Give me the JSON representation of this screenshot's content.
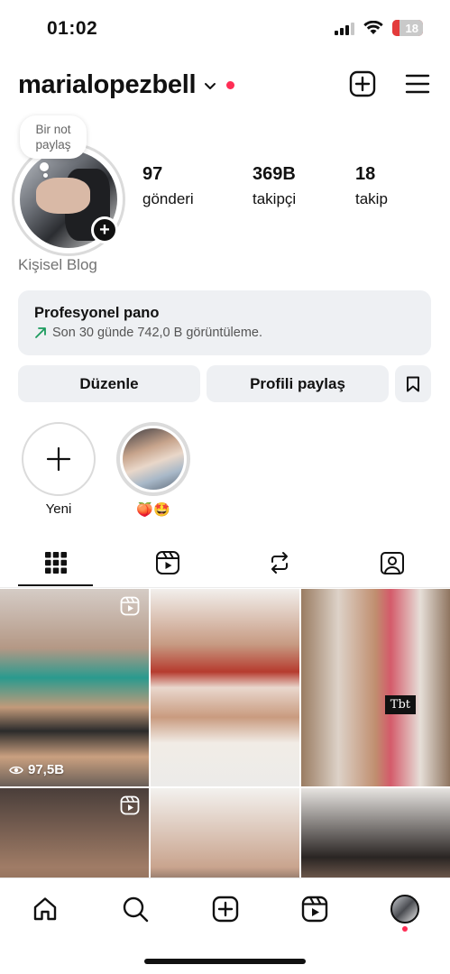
{
  "status_bar": {
    "time": "01:02",
    "battery": "18",
    "battery_color": "#e33b3b"
  },
  "header": {
    "username": "marialopezbell",
    "icons": [
      "chevron-down-icon",
      "notification-dot",
      "new-post-icon",
      "menu-icon"
    ]
  },
  "profile": {
    "note_bubble": "Bir not paylaş",
    "stats": {
      "posts": {
        "value": "97",
        "label": "gönderi"
      },
      "followers": {
        "value": "369B",
        "label": "takipçi"
      },
      "following": {
        "value": "18",
        "label": "takip"
      }
    },
    "bio": "Kişisel Blog"
  },
  "professional_panel": {
    "title": "Profesyonel pano",
    "subtitle": "Son 30 günde 742,0 B görüntüleme."
  },
  "buttons": {
    "edit": "Düzenle",
    "share": "Profili paylaş"
  },
  "highlights": [
    {
      "label": "Yeni"
    },
    {
      "label": "🍑🤩"
    }
  ],
  "tabs": [
    "grid-tab",
    "reels-tab",
    "reposts-tab",
    "tagged-tab"
  ],
  "grid": {
    "posts": [
      {
        "type": "reel",
        "views": "97,5B"
      },
      {
        "type": "photo"
      },
      {
        "type": "photo",
        "sticker": "Tbt"
      },
      {
        "type": "reel"
      },
      {
        "type": "photo"
      },
      {
        "type": "photo"
      }
    ]
  },
  "bottom_nav": [
    "home-icon",
    "search-icon",
    "create-icon",
    "reels-icon",
    "profile-avatar"
  ],
  "colors": {
    "accent_red": "#ff2d55",
    "panel_bg": "#eef0f3",
    "growth_green": "#1c9b5e"
  }
}
